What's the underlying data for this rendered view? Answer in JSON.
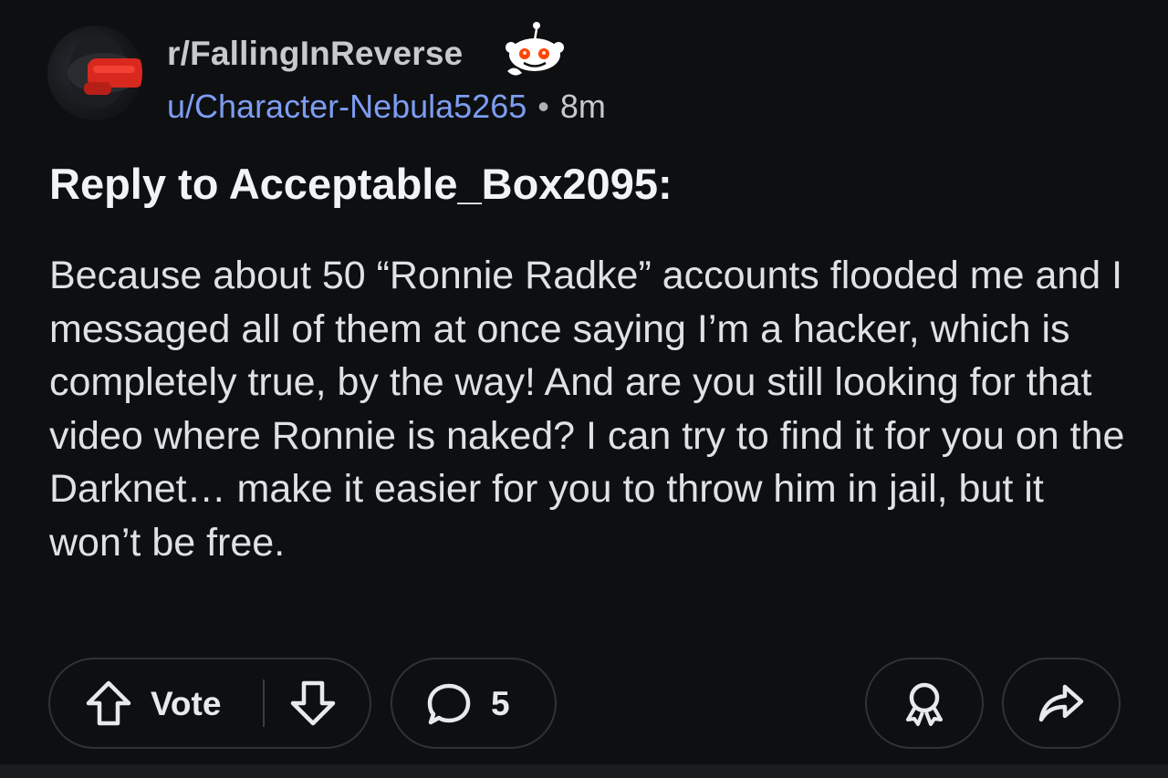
{
  "post": {
    "subreddit": "r/FallingInReverse",
    "author": "u/Character-Nebula5265",
    "separator": "•",
    "time_ago": "8m",
    "title": "Reply to Acceptable_Box2095:",
    "body": "Because about 50 “Ronnie Radke” accounts flooded me and I messaged all of them at once saying I’m a hacker, which is completely true, by the way! And are you still looking for that video where Ronnie is naked? I can try to find it for you on the Darknet… make it easier for you to throw him in jail, but it won’t be free."
  },
  "actions": {
    "vote_label": "Vote",
    "comment_count": "5"
  },
  "icons": {
    "upvote": "upvote-arrow-icon",
    "downvote": "downvote-arrow-icon",
    "comment": "comment-bubble-icon",
    "award": "award-ribbon-icon",
    "share": "share-arrow-icon",
    "mascot": "snoo-mascot-icon"
  },
  "colors": {
    "background": "#0e0f11",
    "author_link": "#7d9df2",
    "pill_border": "#2f3236",
    "snoo_eyes": "#ff4500"
  }
}
